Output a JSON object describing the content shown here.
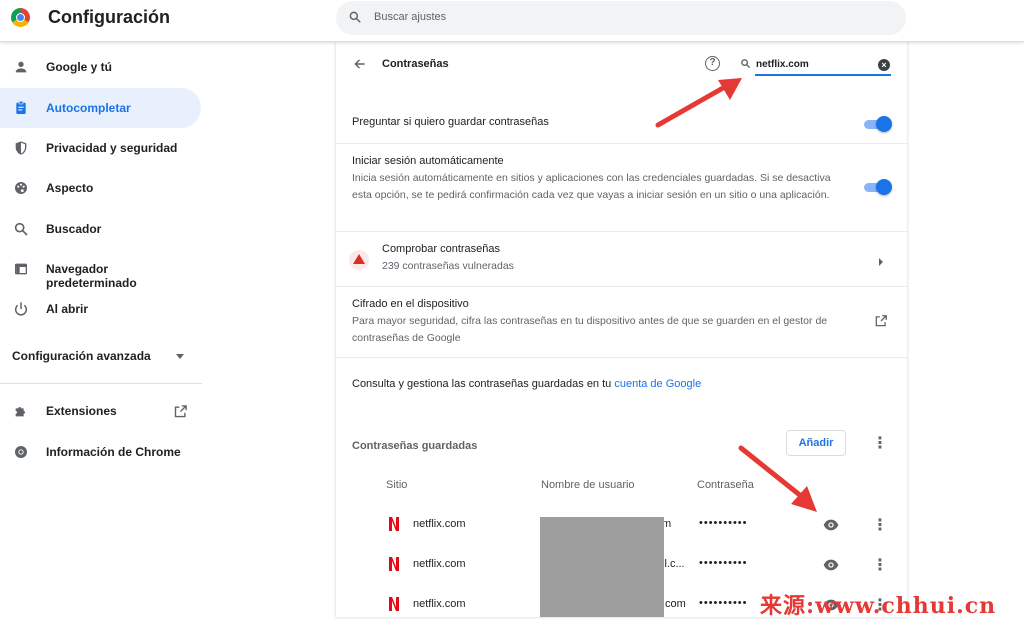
{
  "header": {
    "title": "Configuración",
    "search_placeholder": "Buscar ajustes"
  },
  "sidebar": {
    "items": [
      {
        "label": "Google y tú",
        "icon": "person-icon"
      },
      {
        "label": "Autocompletar",
        "icon": "clipboard-icon",
        "active": true
      },
      {
        "label": "Privacidad y seguridad",
        "icon": "shield-icon"
      },
      {
        "label": "Aspecto",
        "icon": "palette-icon"
      },
      {
        "label": "Buscador",
        "icon": "search-icon"
      },
      {
        "label": "Navegador predeterminado",
        "icon": "browser-icon"
      },
      {
        "label": "Al abrir",
        "icon": "power-icon"
      }
    ],
    "advanced_label": "Configuración avanzada",
    "extensions_label": "Extensiones",
    "about_label": "Información de Chrome"
  },
  "passwords": {
    "title": "Contraseñas",
    "search_value": "netflix.com",
    "offer_to_save_label": "Preguntar si quiero guardar contraseñas",
    "auto_signin_label": "Iniciar sesión automáticamente",
    "auto_signin_desc": "Inicia sesión automáticamente en sitios y aplicaciones con las credenciales guardadas. Si se desactiva esta opción, se te pedirá confirmación cada vez que vayas a iniciar sesión en un sitio o una aplicación.",
    "check_label": "Comprobar contraseñas",
    "check_sub": "239 contraseñas vulneradas",
    "encryption_label": "Cifrado en el dispositivo",
    "encryption_desc": "Para mayor seguridad, cifra las contraseñas en tu dispositivo antes de que se guarden en el gestor de contraseñas de Google",
    "manage_text": "Consulta y gestiona las contraseñas guardadas en tu ",
    "manage_link": "cuenta de Google",
    "saved_title": "Contraseñas guardadas",
    "add_label": "Añadir",
    "columns": {
      "site": "Sitio",
      "username": "Nombre de usuario",
      "password": "Contraseña"
    },
    "rows": [
      {
        "site": "netflix.com",
        "user": "m",
        "password": "••••••••••"
      },
      {
        "site": "netflix.com",
        "user": "il.c...",
        "password": "••••••••••"
      },
      {
        "site": "netflix.com",
        "user": ".com",
        "password": "••••••••••"
      }
    ]
  },
  "watermark": "来源:www.chhui.cn",
  "colors": {
    "accent": "#1a73e8",
    "annotation_arrow": "#e53935",
    "netflix": "#e50914"
  }
}
